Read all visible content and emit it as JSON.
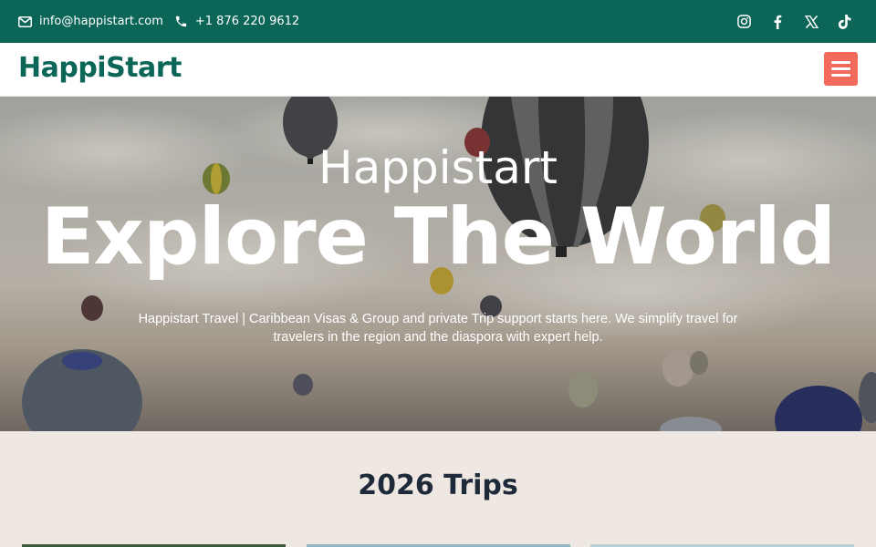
{
  "topbar": {
    "email": "info@happistart.com",
    "phone": "+1 876 220 9612",
    "social": [
      "instagram-icon",
      "facebook-icon",
      "x-icon",
      "tiktok-icon"
    ]
  },
  "header": {
    "logo": "HappiStart",
    "menu_icon": "hamburger-icon"
  },
  "hero": {
    "subtitle": "Happistart",
    "title": "Explore The World",
    "description": "Happistart Travel | Caribbean Visas & Group and private Trip support starts here. We simplify travel for travelers in the region and the diaspora with expert help."
  },
  "trips": {
    "heading": "2026 Trips"
  },
  "colors": {
    "brand": "#0b6657",
    "accent": "#f26a5c",
    "heading": "#1e2a3a",
    "section_bg": "#efe8e2"
  }
}
